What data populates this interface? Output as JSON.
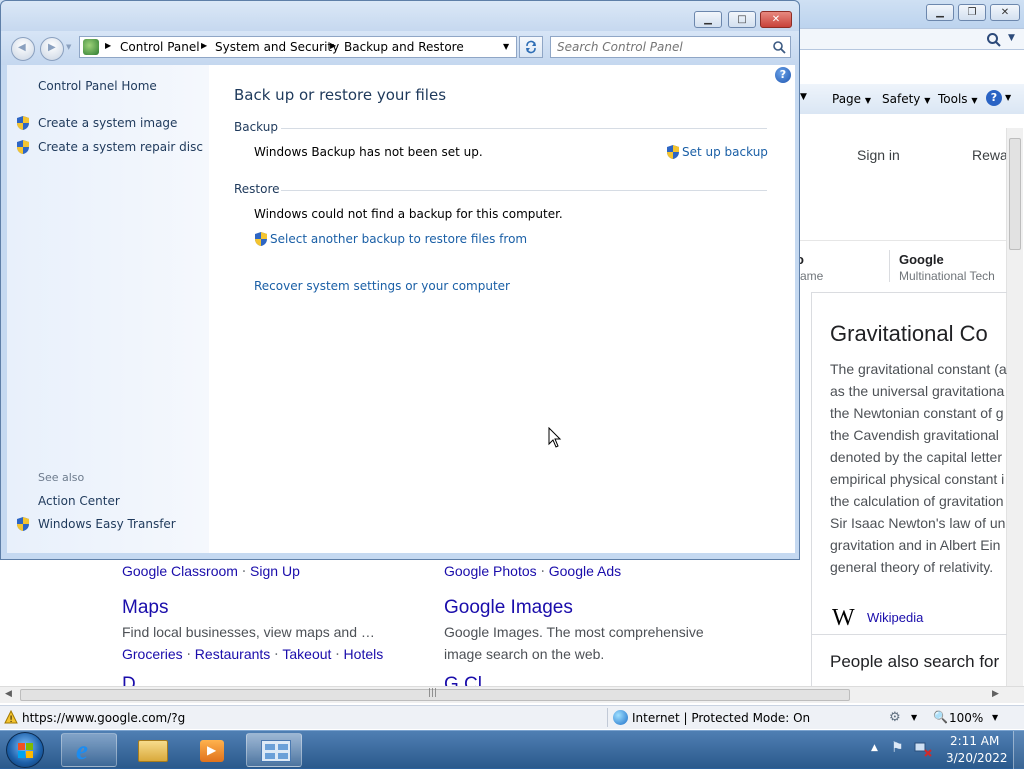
{
  "ie": {
    "caption_buttons": [
      "minimize",
      "restore",
      "close"
    ],
    "command_bar": [
      "Page",
      "Safety",
      "Tools"
    ],
    "search_icon": "search-icon",
    "header": {
      "sign_in": "Sign in",
      "rewards": "Rewa"
    },
    "knowledge": {
      "left_frag_1": "o",
      "left_frag_2": "ame",
      "google_title": "Google",
      "google_sub": "Multinational Tech"
    },
    "wiki": {
      "title": "Gravitational Co",
      "lines": [
        "The gravitational constant (a",
        "as the universal gravitationa",
        "the Newtonian constant of g",
        "the Cavendish gravitational",
        "denoted by the capital letter",
        "empirical physical constant i",
        "the calculation of gravitation",
        "Sir Isaac Newton's law of un",
        "gravitation and in Albert Ein",
        "general theory of relativity."
      ],
      "source_icon": "W",
      "source_label": "Wikipedia",
      "people_also": "People also search for"
    },
    "results": {
      "classroom": "Google Classroom",
      "signup": "Sign Up",
      "photos": "Google Photos",
      "ads": "Google Ads",
      "maps_title": "Maps",
      "maps_desc": "Find local businesses, view maps and …",
      "maps_links": [
        "Groceries",
        "Restaurants",
        "Takeout",
        "Hotels"
      ],
      "images_title": "Google Images",
      "images_desc_1": "Google Images. The most comprehensive",
      "images_desc_2": "image search on the web.",
      "cut_left": "D",
      "cut_right": "G Cl"
    },
    "status": {
      "url": "https://www.google.com/?g",
      "zone": "Internet | Protected Mode: On",
      "zoom": "100%"
    }
  },
  "cp": {
    "breadcrumb": [
      "Control Panel",
      "System and Security",
      "Backup and Restore"
    ],
    "search_placeholder": "Search Control Panel",
    "sidebar": {
      "home": "Control Panel Home",
      "tasks": [
        "Create a system image",
        "Create a system repair disc"
      ],
      "see_also": "See also",
      "see_also_links": [
        "Action Center",
        "Windows Easy Transfer"
      ]
    },
    "main": {
      "title": "Back up or restore your files",
      "backup_label": "Backup",
      "backup_status": "Windows Backup has not been set up.",
      "setup_link": "Set up backup",
      "restore_label": "Restore",
      "restore_status": "Windows could not find a backup for this computer.",
      "select_backup_link": "Select another backup to restore files from",
      "recover_link": "Recover system settings or your computer"
    }
  },
  "taskbar": {
    "time": "2:11 AM",
    "date": "3/20/2022",
    "apps": [
      "internet-explorer",
      "windows-explorer",
      "media-player",
      "control-panel"
    ]
  },
  "colors": {
    "link": "#1a5fa6",
    "google_link": "#1a0dab",
    "title_blue": "#1e395b",
    "close_red": "#c8423a"
  }
}
